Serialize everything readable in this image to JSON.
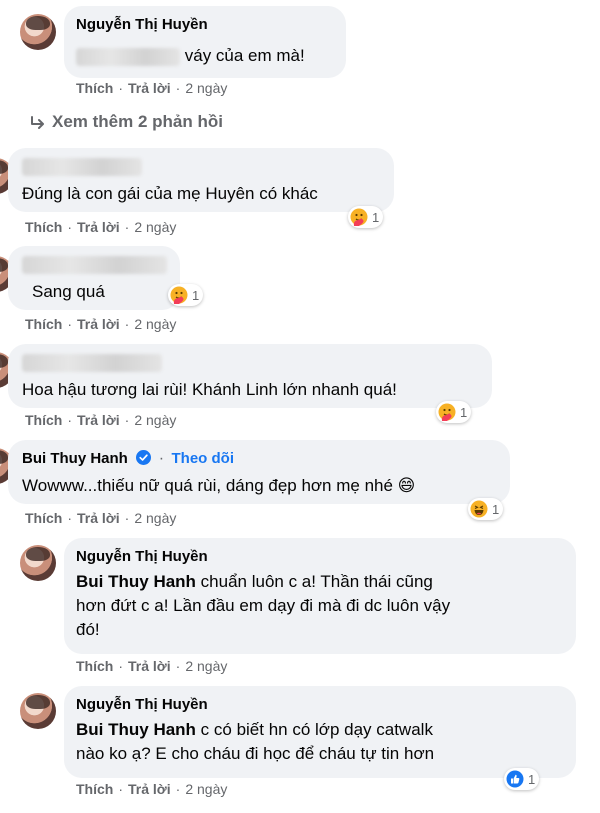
{
  "actions": {
    "like": "Thích",
    "reply": "Trả lời",
    "sep": "·"
  },
  "comments": [
    {
      "name": "Nguyễn Thị Huyền",
      "text": "váy của em mà!",
      "time": "2 ngày"
    },
    {
      "text": "Đúng là con gái của mẹ Huyên có khác",
      "time": "2 ngày",
      "reactions": "1"
    },
    {
      "text": "Sang quá",
      "time": "2 ngày",
      "reactions": "1"
    },
    {
      "text": "Hoa hậu tương lai rùi! Khánh Linh lớn nhanh quá!",
      "time": "2 ngày",
      "reactions": "1"
    },
    {
      "name": "Bui Thuy Hanh",
      "follow": "Theo dõi",
      "dot": "·",
      "text": "Wowww...thiếu nữ quá rùi, dáng đẹp hơn mẹ nhé 😄",
      "time": "2 ngày",
      "reactions": "1"
    },
    {
      "name": "Nguyễn Thị Huyền",
      "mention": "Bui Thuy Hanh",
      "text1": " chuẩn luôn c a! Thần thái cũng",
      "text2": "hơn đứt c a! Lần đầu em dạy đi mà đi dc luôn vậy",
      "text3": "đó!",
      "time": "2 ngày"
    },
    {
      "name": "Nguyễn Thị Huyền",
      "mention": "Bui Thuy Hanh",
      "text1": " c có biết hn có lớp dạy catwalk",
      "text2": "nào ko ạ? E cho cháu đi học để cháu tự tin hơn",
      "time": "2 ngày",
      "reactions": "1"
    }
  ],
  "view_more": "Xem thêm 2 phản hồi",
  "icons": {
    "haha": "haha-reaction-icon",
    "care": "care-reaction-icon",
    "like": "like-reaction-icon",
    "verified": "verified-badge-icon",
    "reply_arrow": "reply-arrow-icon"
  },
  "colors": {
    "bubble": "#f0f2f5",
    "meta": "#65676b",
    "link": "#1877f2"
  }
}
